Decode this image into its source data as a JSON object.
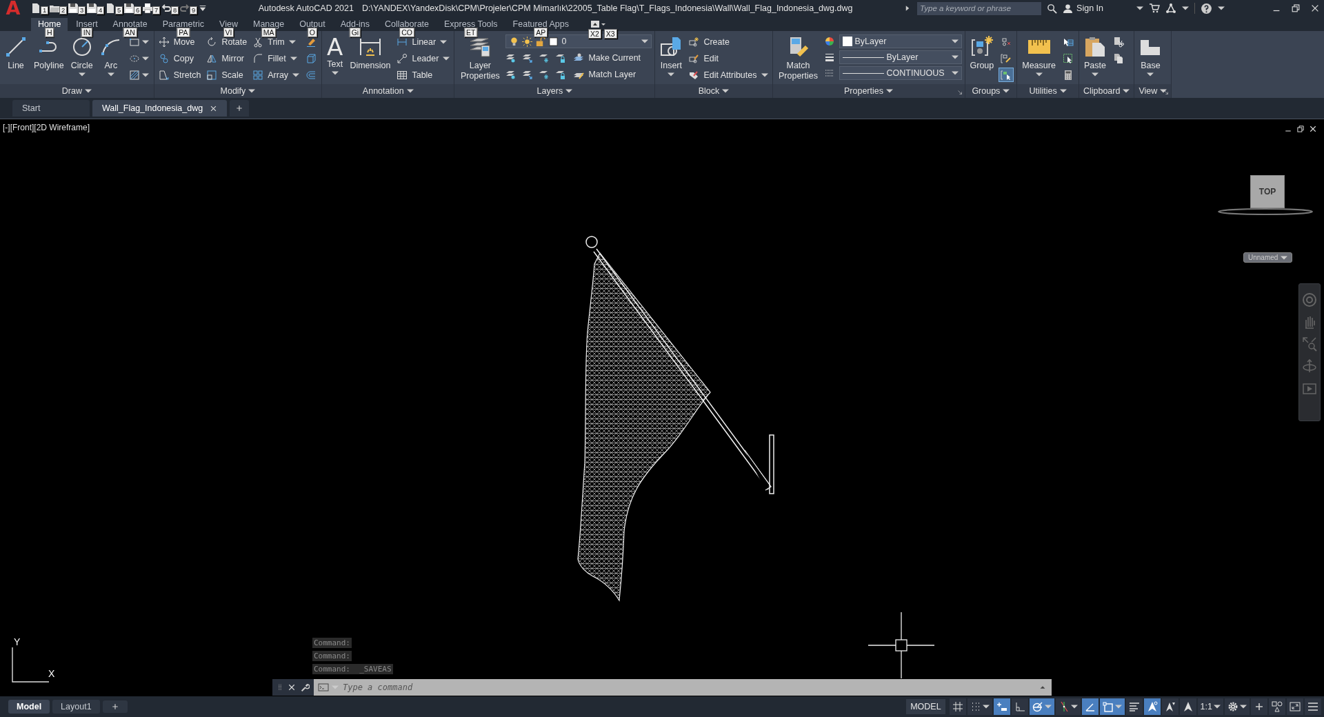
{
  "title_bar": {
    "logo": "A",
    "quick_access": [
      {
        "keytip": "1"
      },
      {
        "keytip": "2"
      },
      {
        "keytip": "3"
      },
      {
        "keytip": "4"
      },
      {
        "keytip": "5"
      },
      {
        "keytip": "6"
      },
      {
        "keytip": "7"
      },
      {
        "keytip": "8"
      },
      {
        "keytip": "9"
      }
    ],
    "app_title": "Autodesk AutoCAD 2021",
    "file_path": "D:\\YANDEX\\YandexDisk\\CPM\\Projeler\\CPM Mimarlık\\22005_Table Flag\\T_Flags_Indonesia\\Wall\\Wall_Flag_Indonesia_dwg.dwg",
    "search": {
      "placeholder": "Type a keyword or phrase"
    },
    "sign_in": "Sign In"
  },
  "ribbon_tabs": [
    {
      "label": "Home",
      "keytip": "H",
      "selected": true
    },
    {
      "label": "Insert",
      "keytip": "IN",
      "selected": false
    },
    {
      "label": "Annotate",
      "keytip": "AN",
      "selected": false
    },
    {
      "label": "Parametric",
      "keytip": "PA",
      "selected": false
    },
    {
      "label": "View",
      "keytip": "VI",
      "selected": false
    },
    {
      "label": "Manage",
      "keytip": "MA",
      "selected": false
    },
    {
      "label": "Output",
      "keytip": "O",
      "selected": false
    },
    {
      "label": "Add-ins",
      "keytip": "Gi",
      "selected": false
    },
    {
      "label": "Collaborate",
      "keytip": "CO",
      "selected": false
    },
    {
      "label": "Express Tools",
      "keytip": "ET",
      "selected": false
    },
    {
      "label": "Featured Apps",
      "keytip": "AP",
      "selected": false
    }
  ],
  "tab_overflow": {
    "keytips": [
      "X2",
      "X3"
    ]
  },
  "ribbon_panels": [
    {
      "title": "Draw",
      "columns": [
        [
          {
            "kind": "large",
            "label": "Line",
            "dropdown": false
          }
        ],
        [
          {
            "kind": "large",
            "label": "Polyline",
            "dropdown": false
          }
        ],
        [
          {
            "kind": "large",
            "label": "Circle",
            "dropdown": true
          }
        ],
        [
          {
            "kind": "large",
            "label": "Arc",
            "dropdown": true
          }
        ],
        [
          {
            "kind": "icon",
            "dropdown": true
          },
          {
            "kind": "icon",
            "dropdown": true
          },
          {
            "kind": "icon",
            "dropdown": true
          }
        ]
      ]
    },
    {
      "title": "Modify",
      "columns": [
        [
          {
            "kind": "small",
            "label": "Move",
            "dropdown": false
          },
          {
            "kind": "small",
            "label": "Copy",
            "dropdown": false
          },
          {
            "kind": "small",
            "label": "Stretch",
            "dropdown": false
          }
        ],
        [
          {
            "kind": "small",
            "label": "Rotate",
            "dropdown": false
          },
          {
            "kind": "small",
            "label": "Mirror",
            "dropdown": false
          },
          {
            "kind": "small",
            "label": "Scale",
            "dropdown": false
          }
        ],
        [
          {
            "kind": "small",
            "label": "Trim",
            "dropdown": true
          },
          {
            "kind": "small",
            "label": "Fillet",
            "dropdown": true
          },
          {
            "kind": "small",
            "label": "Array",
            "dropdown": true
          }
        ],
        [
          {
            "kind": "icon",
            "dropdown": false
          },
          {
            "kind": "icon",
            "dropdown": false
          },
          {
            "kind": "icon",
            "dropdown": false
          }
        ]
      ]
    },
    {
      "title": "Annotation",
      "columns": [
        [
          {
            "kind": "glyph_large",
            "glyph": "A",
            "label": "Text",
            "dropdown": true
          }
        ],
        [
          {
            "kind": "large",
            "label": "Dimension",
            "dropdown": false
          }
        ],
        [
          {
            "kind": "small",
            "label": "Linear",
            "dropdown": true
          },
          {
            "kind": "small",
            "label": "Leader",
            "dropdown": true
          },
          {
            "kind": "small",
            "label": "Table",
            "dropdown": false
          }
        ]
      ]
    },
    {
      "title": "Layers",
      "columns": [
        [
          {
            "kind": "large",
            "label": "Layer Properties",
            "dropdown": false
          }
        ],
        [
          {
            "kind": "layer_combo",
            "value": "0"
          },
          {
            "kind": "layer_tools",
            "label": "Make Current"
          },
          {
            "kind": "layer_tools",
            "label": "Match Layer"
          }
        ]
      ]
    },
    {
      "title": "Block",
      "columns": [
        [
          {
            "kind": "large",
            "label": "Insert",
            "dropdown": true
          }
        ],
        [
          {
            "kind": "small",
            "label": "Create",
            "dropdown": false
          },
          {
            "kind": "small",
            "label": "Edit",
            "dropdown": false
          },
          {
            "kind": "small",
            "label": "Edit Attributes",
            "dropdown": true
          }
        ]
      ]
    },
    {
      "title": "Properties",
      "launcher": true,
      "columns": [
        [
          {
            "kind": "large",
            "label": "Match Properties",
            "dropdown": false
          }
        ],
        [
          {
            "kind": "color_combo",
            "value": "ByLayer"
          },
          {
            "kind": "line_combo",
            "value": "ByLayer"
          },
          {
            "kind": "line_combo",
            "value": "CONTINUOUS"
          }
        ]
      ]
    },
    {
      "title": "Groups",
      "launcher": false,
      "columns": [
        [
          {
            "kind": "large",
            "label": "Group",
            "dropdown": false
          }
        ],
        [
          {
            "kind": "icon",
            "dropdown": false,
            "on": false
          },
          {
            "kind": "icon",
            "dropdown": false,
            "on": false
          },
          {
            "kind": "icon",
            "dropdown": false,
            "on": true
          }
        ]
      ]
    },
    {
      "title": "Utilities",
      "columns": [
        [
          {
            "kind": "large",
            "label": "Measure",
            "dropdown": true
          }
        ],
        [
          {
            "kind": "icon",
            "dropdown": false
          },
          {
            "kind": "icon",
            "dropdown": false
          },
          {
            "kind": "icon",
            "dropdown": false
          }
        ]
      ]
    },
    {
      "title": "Clipboard",
      "columns": [
        [
          {
            "kind": "large",
            "label": "Paste",
            "dropdown": true
          }
        ],
        [
          {
            "kind": "icon",
            "dropdown": false
          },
          {
            "kind": "icon",
            "dropdown": false
          }
        ]
      ]
    },
    {
      "title": "View",
      "launcher": true,
      "columns": [
        [
          {
            "kind": "large",
            "label": "Base",
            "dropdown": true
          }
        ]
      ]
    }
  ],
  "file_tabs": [
    {
      "label": "Start",
      "selected": false
    },
    {
      "label": "Wall_Flag_Indonesia_dwg",
      "selected": true
    }
  ],
  "viewport": {
    "label": "[-][Front][2D Wireframe]",
    "viewcube_face": "TOP",
    "named_view": "Unnamed",
    "ucs": {
      "y": "Y",
      "x": "X"
    }
  },
  "command_history": [
    "Command:",
    "Command:",
    "Command:  _SAVEAS"
  ],
  "command_line": {
    "placeholder": "Type a command"
  },
  "status_bar": {
    "layout_tabs": [
      {
        "label": "Model",
        "selected": true
      },
      {
        "label": "Layout1",
        "selected": false
      }
    ],
    "space": "MODEL",
    "toggles": [
      {
        "on": false,
        "dropdown": false
      },
      {
        "on": false,
        "dropdown": true
      },
      {
        "on": true,
        "dropdown": false
      },
      {
        "on": false,
        "dropdown": false
      },
      {
        "on": true,
        "dropdown": true
      },
      {
        "on": false,
        "dropdown": true
      },
      {
        "on": true,
        "dropdown": false
      },
      {
        "on": true,
        "dropdown": true
      },
      {
        "on": false,
        "dropdown": false
      },
      {
        "on": true,
        "dropdown": false
      },
      {
        "on": false,
        "dropdown": false
      },
      {
        "on": false,
        "dropdown": false
      },
      {
        "label": "1:1",
        "on": false,
        "dropdown": true
      },
      {
        "on": false,
        "dropdown": true
      },
      {
        "on": false,
        "dropdown": false
      },
      {
        "on": false,
        "dropdown": false
      },
      {
        "on": false,
        "dropdown": false
      },
      {
        "on": false,
        "dropdown": false
      }
    ]
  }
}
